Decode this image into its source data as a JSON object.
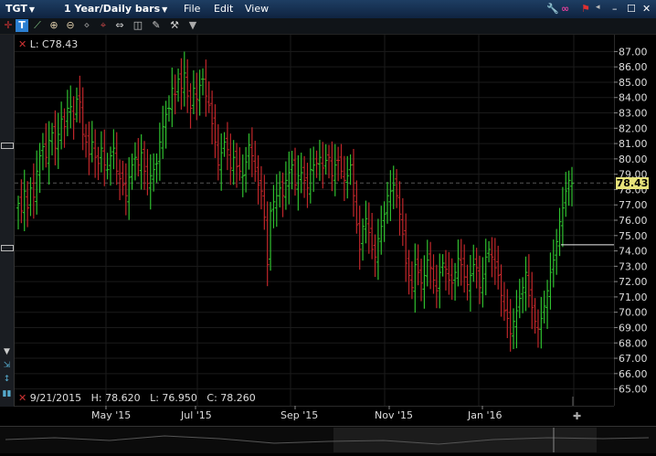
{
  "window": {
    "symbol": "TGT",
    "period": "1 Year/Daily bars",
    "menus": [
      "File",
      "Edit",
      "View"
    ]
  },
  "chart_header": {
    "last_label": "L: C78.43"
  },
  "ohlc": {
    "date": "9/21/2015",
    "high": "H: 78.620",
    "low": "L: 76.950",
    "close": "C: 78.260"
  },
  "last_price_badge": "78.43",
  "colors": {
    "up": "#2fbf2f",
    "down": "#c0262a",
    "grid": "#333333",
    "badge": "#e6e27a",
    "titlebar": "#1e3e63"
  },
  "icons": [
    "wrench-icon",
    "link-icon",
    "flag-icon",
    "minimize-icon",
    "maximize-icon",
    "close-icon"
  ],
  "toolbar_tools": [
    "crosshair-icon",
    "text-icon",
    "zoom-in-icon",
    "zoom-out-icon",
    "cursor-icon",
    "pan-icon",
    "scale-icon",
    "tools-icon",
    "dropdown-icon"
  ],
  "chart_data": {
    "type": "ohlc",
    "y_ticks": [
      "87.00",
      "86.00",
      "85.00",
      "84.00",
      "83.00",
      "82.00",
      "81.00",
      "80.00",
      "79.00",
      "78.00",
      "77.00",
      "76.00",
      "75.00",
      "74.00",
      "73.00",
      "72.00",
      "71.00",
      "70.00",
      "69.00",
      "68.00",
      "67.00",
      "66.00",
      "65.00"
    ],
    "ylim": [
      64.5,
      87.5
    ],
    "x_labels": [
      "May '15",
      "Jul '15",
      "Sep '15",
      "Nov '15",
      "Jan '16"
    ],
    "last_value": 78.43,
    "horizontal_level": 74.4,
    "closes": [
      77.1,
      76.6,
      77.9,
      76.8,
      78.1,
      77.5,
      79.2,
      80.2,
      80.8,
      80.1,
      81.2,
      81.7,
      80.7,
      81.6,
      82.6,
      82.1,
      83.3,
      83.4,
      82.6,
      83.9,
      83.7,
      81.6,
      81.1,
      80.3,
      81.1,
      80.1,
      79.7,
      80.7,
      79.6,
      79.3,
      80.2,
      80.7,
      79.2,
      78.7,
      78.3,
      77.6,
      78.8,
      79.6,
      80.1,
      79.6,
      80.4,
      79.2,
      78.4,
      78.9,
      79.3,
      79.7,
      81.1,
      82.1,
      82.9,
      83.3,
      84.6,
      84.2,
      85.2,
      84.6,
      85.6,
      84.1,
      83.3,
      84.6,
      83.9,
      84.8,
      85.2,
      84.1,
      83.5,
      82.3,
      81.1,
      79.6,
      80.4,
      81.1,
      80.6,
      79.4,
      80.1,
      79.5,
      79.2,
      78.9,
      79.8,
      80.9,
      80.2,
      79.2,
      78.3,
      77.9,
      76.2,
      73.1,
      76.6,
      77.2,
      77.6,
      78.1,
      77.6,
      78.6,
      79.1,
      79.6,
      78.3,
      78.9,
      79.1,
      78.6,
      78.1,
      79.3,
      79.6,
      79.7,
      80.1,
      79.4,
      79.9,
      80.1,
      78.9,
      79.6,
      79.9,
      79.2,
      78.6,
      78.9,
      79.6,
      77.6,
      75.7,
      74.1,
      75.6,
      76.1,
      75.2,
      74.1,
      73.6,
      74.8,
      75.6,
      76.4,
      77.6,
      77.9,
      78.3,
      77.6,
      76.4,
      75.1,
      73.2,
      72.4,
      71.6,
      73.1,
      72.6,
      71.9,
      72.4,
      73.4,
      72.9,
      72.1,
      71.4,
      72.6,
      73.2,
      72.8,
      72.1,
      71.9,
      72.6,
      73.5,
      73.1,
      72.3,
      71.8,
      72.4,
      73.1,
      72.9,
      71.6,
      72.2,
      73.6,
      74.1,
      73.6,
      72.9,
      72.4,
      71.1,
      70.1,
      69.6,
      68.6,
      69.4,
      70.1,
      70.9,
      71.6,
      72.6,
      71.1,
      70.3,
      69.4,
      68.9,
      69.6,
      70.4,
      71.4,
      72.6,
      73.4,
      74.6,
      75.9,
      76.8,
      77.9,
      78.6,
      78.4
    ]
  }
}
